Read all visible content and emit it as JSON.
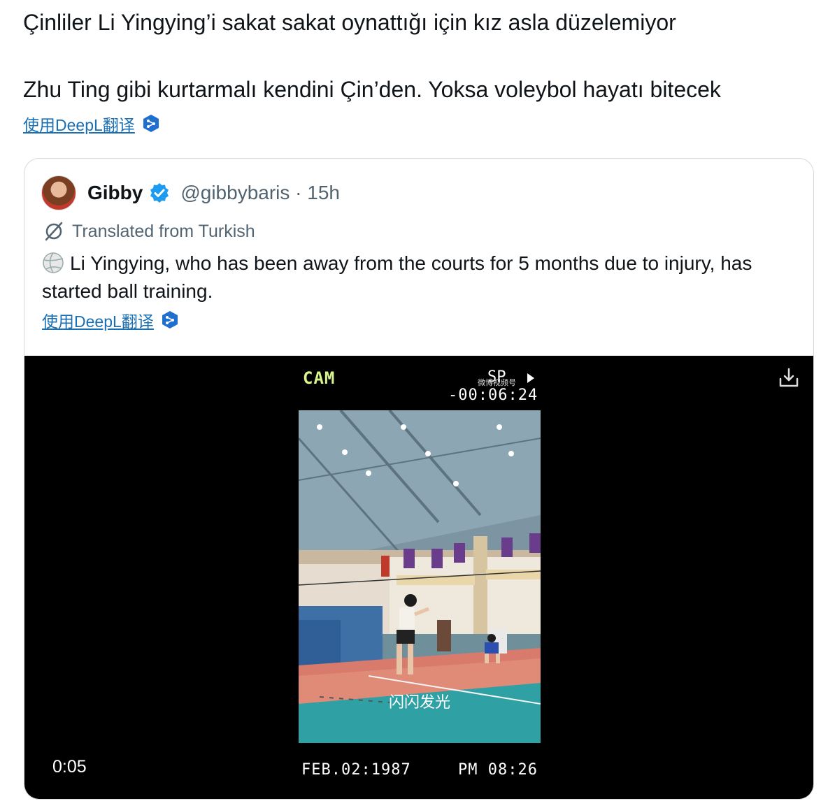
{
  "tweet": {
    "line1": "Çinliler Li Yingying’i sakat sakat oynattığı için kız asla düzelemiyor",
    "line2": "Zhu Ting gibi kurtarmalı kendini Çin’den. Yoksa voleybol hayatı bitecek",
    "translate_label": "使用DeepL翻译"
  },
  "quote": {
    "name": "Gibby",
    "handle": "@gibbybaris · 15h",
    "translated_from": "Translated from Turkish",
    "body": "Li Yingying, who has been away from the courts for 5 months due to injury, has started ball training.",
    "translate_label": "使用DeepL翻译"
  },
  "video": {
    "cam": "CAM",
    "sp": "SP",
    "timecode": "-00:06:24",
    "watermark": "微博视频号",
    "subtitle": "闪闪发光",
    "elapsed": "0:05",
    "date": "FEB.02:1987",
    "time": "PM 08:26"
  },
  "colors": {
    "link": "#1a6fb3",
    "deepl": "#1f6fd1",
    "verified": "#1d9bf0",
    "cam": "#d9f48a"
  }
}
